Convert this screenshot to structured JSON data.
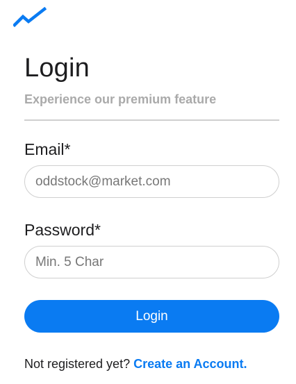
{
  "logo": {
    "icon": "trend-line-icon",
    "color": "#0a7bf2"
  },
  "header": {
    "title": "Login",
    "subtitle": "Experience our premium feature"
  },
  "form": {
    "email_label": "Email*",
    "email_placeholder": "oddstock@market.com",
    "password_label": "Password*",
    "password_placeholder": "Min. 5 Char",
    "login_button": "Login"
  },
  "footer": {
    "prompt": "Not registered yet?",
    "create_link": "Create an Account."
  },
  "colors": {
    "accent": "#0a7bf2",
    "muted_text": "#aaaaaa",
    "border": "#cfcfcf"
  }
}
